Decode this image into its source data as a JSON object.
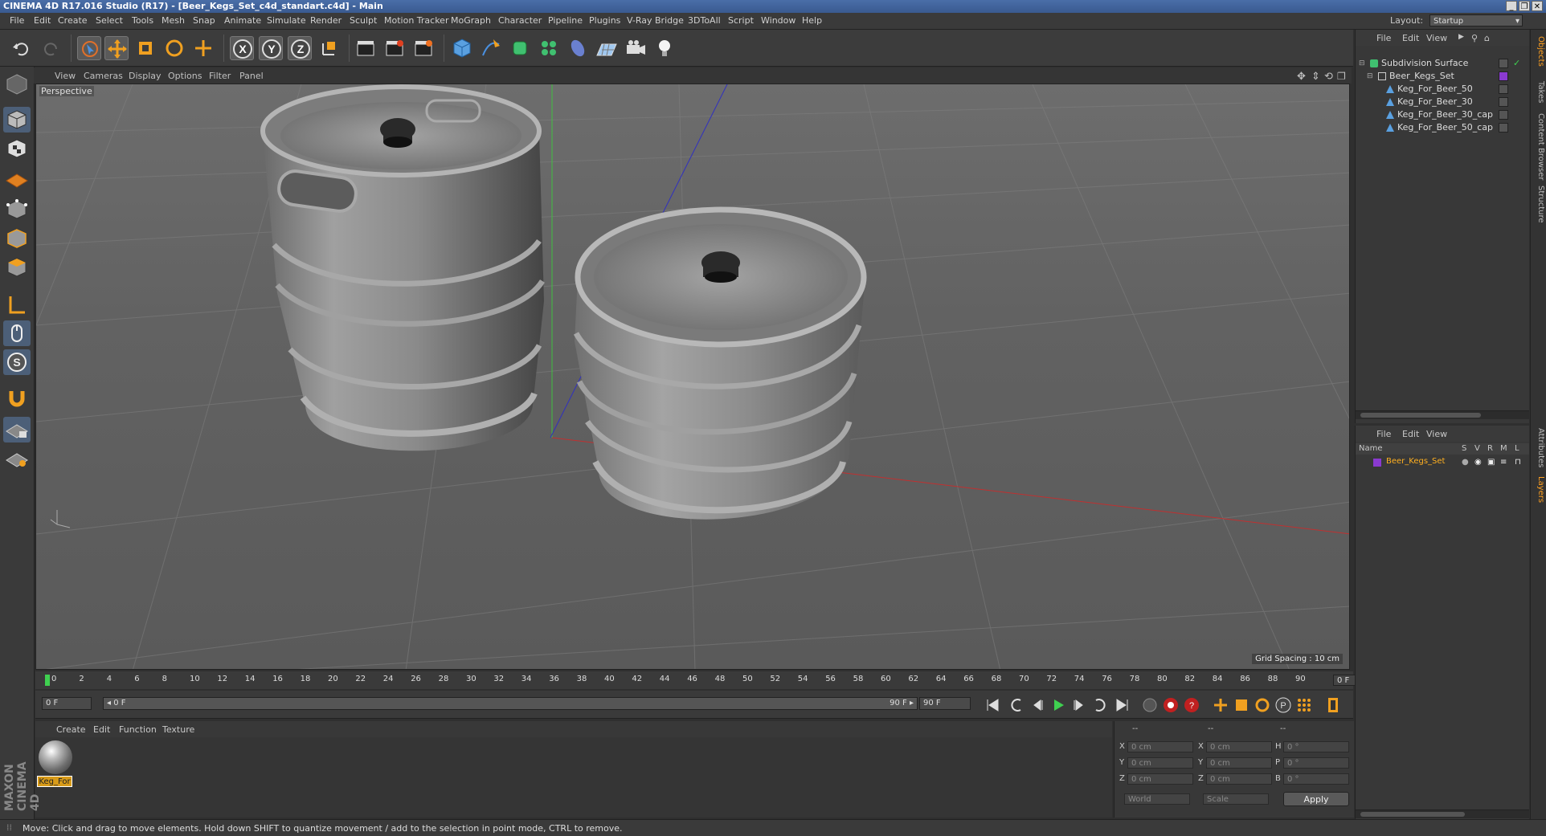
{
  "window": {
    "title": "CINEMA 4D R17.016 Studio (R17) - [Beer_Kegs_Set_c4d_standart.c4d] - Main",
    "controls": [
      "_",
      "❐",
      "✕"
    ]
  },
  "menubar": {
    "items": [
      "File",
      "Edit",
      "Create",
      "Select",
      "Tools",
      "Mesh",
      "Snap",
      "Animate",
      "Simulate",
      "Render",
      "Sculpt",
      "Motion Tracker",
      "MoGraph",
      "Character",
      "Pipeline",
      "Plugins",
      "V-Ray Bridge",
      "3DToAll",
      "Script",
      "Window",
      "Help"
    ],
    "layout_label": "Layout:",
    "layout_value": "Startup"
  },
  "toolbar": {
    "axis_x": "X",
    "axis_y": "Y",
    "axis_z": "Z"
  },
  "viewport": {
    "menu": [
      "View",
      "Cameras",
      "Display",
      "Options",
      "Filter",
      "Panel"
    ],
    "camera_label": "Perspective",
    "grid_spacing": "Grid Spacing : 10 cm"
  },
  "timeline": {
    "ticks": [
      "0",
      "2",
      "4",
      "6",
      "8",
      "10",
      "12",
      "14",
      "16",
      "18",
      "20",
      "22",
      "24",
      "26",
      "28",
      "30",
      "32",
      "34",
      "36",
      "38",
      "40",
      "42",
      "44",
      "46",
      "48",
      "50",
      "52",
      "54",
      "56",
      "58",
      "60",
      "62",
      "64",
      "66",
      "68",
      "70",
      "72",
      "74",
      "76",
      "78",
      "80",
      "82",
      "84",
      "86",
      "88",
      "90"
    ],
    "current_frame": "0 F",
    "start_field": "0 F",
    "range_start": "◂ 0 F",
    "range_end": "90 F ▸",
    "end_field": "90 F"
  },
  "material_manager": {
    "menu": [
      "Create",
      "Edit",
      "Function",
      "Texture"
    ],
    "material_name": "Keg_For"
  },
  "coordinates": {
    "headers": [
      "--",
      "--",
      "--"
    ],
    "rows": [
      {
        "pos_label": "X",
        "pos": "0 cm",
        "size_label": "X",
        "size": "0 cm",
        "rot_label": "H",
        "rot": "0 °"
      },
      {
        "pos_label": "Y",
        "pos": "0 cm",
        "size_label": "Y",
        "size": "0 cm",
        "rot_label": "P",
        "rot": "0 °"
      },
      {
        "pos_label": "Z",
        "pos": "0 cm",
        "size_label": "Z",
        "size": "0 cm",
        "rot_label": "B",
        "rot": "0 °"
      }
    ],
    "mode_world": "World",
    "mode_scale": "Scale",
    "apply": "Apply"
  },
  "object_manager": {
    "menu": [
      "File",
      "Edit",
      "View"
    ],
    "items": [
      {
        "name": "Subdivision Surface",
        "indent": 0
      },
      {
        "name": "Beer_Kegs_Set",
        "indent": 1
      },
      {
        "name": "Keg_For_Beer_50",
        "indent": 2
      },
      {
        "name": "Keg_For_Beer_30",
        "indent": 2
      },
      {
        "name": "Keg_For_Beer_30_cap",
        "indent": 2
      },
      {
        "name": "Keg_For_Beer_50_cap",
        "indent": 2
      }
    ]
  },
  "layer_manager": {
    "menu": [
      "File",
      "Edit",
      "View"
    ],
    "columns": [
      "Name",
      "S",
      "V",
      "R",
      "M",
      "L"
    ],
    "layer_name": "Beer_Kegs_Set"
  },
  "side_tabs": [
    "Objects",
    "Takes",
    "Content Browser",
    "Structure",
    "Attributes",
    "Layers"
  ],
  "status": "Move: Click and drag to move elements. Hold down SHIFT to quantize movement / add to the selection in point mode, CTRL to remove.",
  "logo": "MAXON CINEMA 4D",
  "colors": {
    "accent": "#ffa020",
    "selection": "#4c5f78",
    "layer_color": "#8a3ad0"
  }
}
